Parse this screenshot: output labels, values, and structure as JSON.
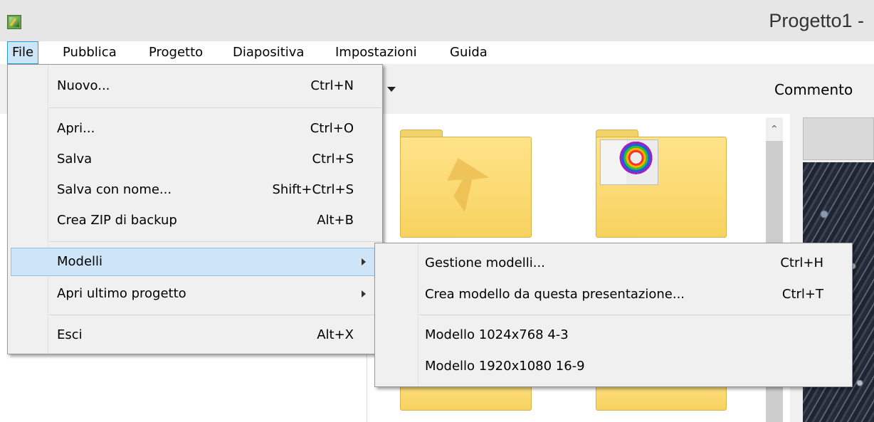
{
  "window": {
    "title": "Progetto1 -"
  },
  "menubar": {
    "items": [
      {
        "label": "File"
      },
      {
        "label": "Pubblica"
      },
      {
        "label": "Progetto"
      },
      {
        "label": "Diapositiva"
      },
      {
        "label": "Impostazioni"
      },
      {
        "label": "Guida"
      }
    ]
  },
  "background": {
    "comment_label": "Commento"
  },
  "file_menu": {
    "items": [
      {
        "label": "Nuovo...",
        "shortcut": "Ctrl+N"
      },
      {
        "label": "Apri...",
        "shortcut": "Ctrl+O"
      },
      {
        "label": "Salva",
        "shortcut": "Ctrl+S"
      },
      {
        "label": "Salva con nome...",
        "shortcut": "Shift+Ctrl+S"
      },
      {
        "label": "Crea ZIP di backup",
        "shortcut": "Alt+B"
      },
      {
        "label": "Modelli",
        "shortcut": ""
      },
      {
        "label": "Apri ultimo progetto",
        "shortcut": ""
      },
      {
        "label": "Esci",
        "shortcut": "Alt+X"
      }
    ]
  },
  "modelli_submenu": {
    "items": [
      {
        "label": "Gestione modelli...",
        "shortcut": "Ctrl+H"
      },
      {
        "label": "Crea modello da questa presentazione...",
        "shortcut": "Ctrl+T"
      },
      {
        "label": "Modello 1024x768 4-3",
        "shortcut": ""
      },
      {
        "label": "Modello 1920x1080 16-9",
        "shortcut": ""
      }
    ]
  },
  "colors": {
    "menu_highlight": "#cde5f7",
    "menu_highlight_border": "#26a0da",
    "menu_background": "#f0f0f0",
    "folder_yellow": "#f7d25f"
  },
  "icons": [
    "app-icon",
    "dropdown-arrow-icon",
    "scroll-up-arrow-icon",
    "submenu-arrow-icon",
    "folder-icon",
    "up-arrow-icon"
  ]
}
